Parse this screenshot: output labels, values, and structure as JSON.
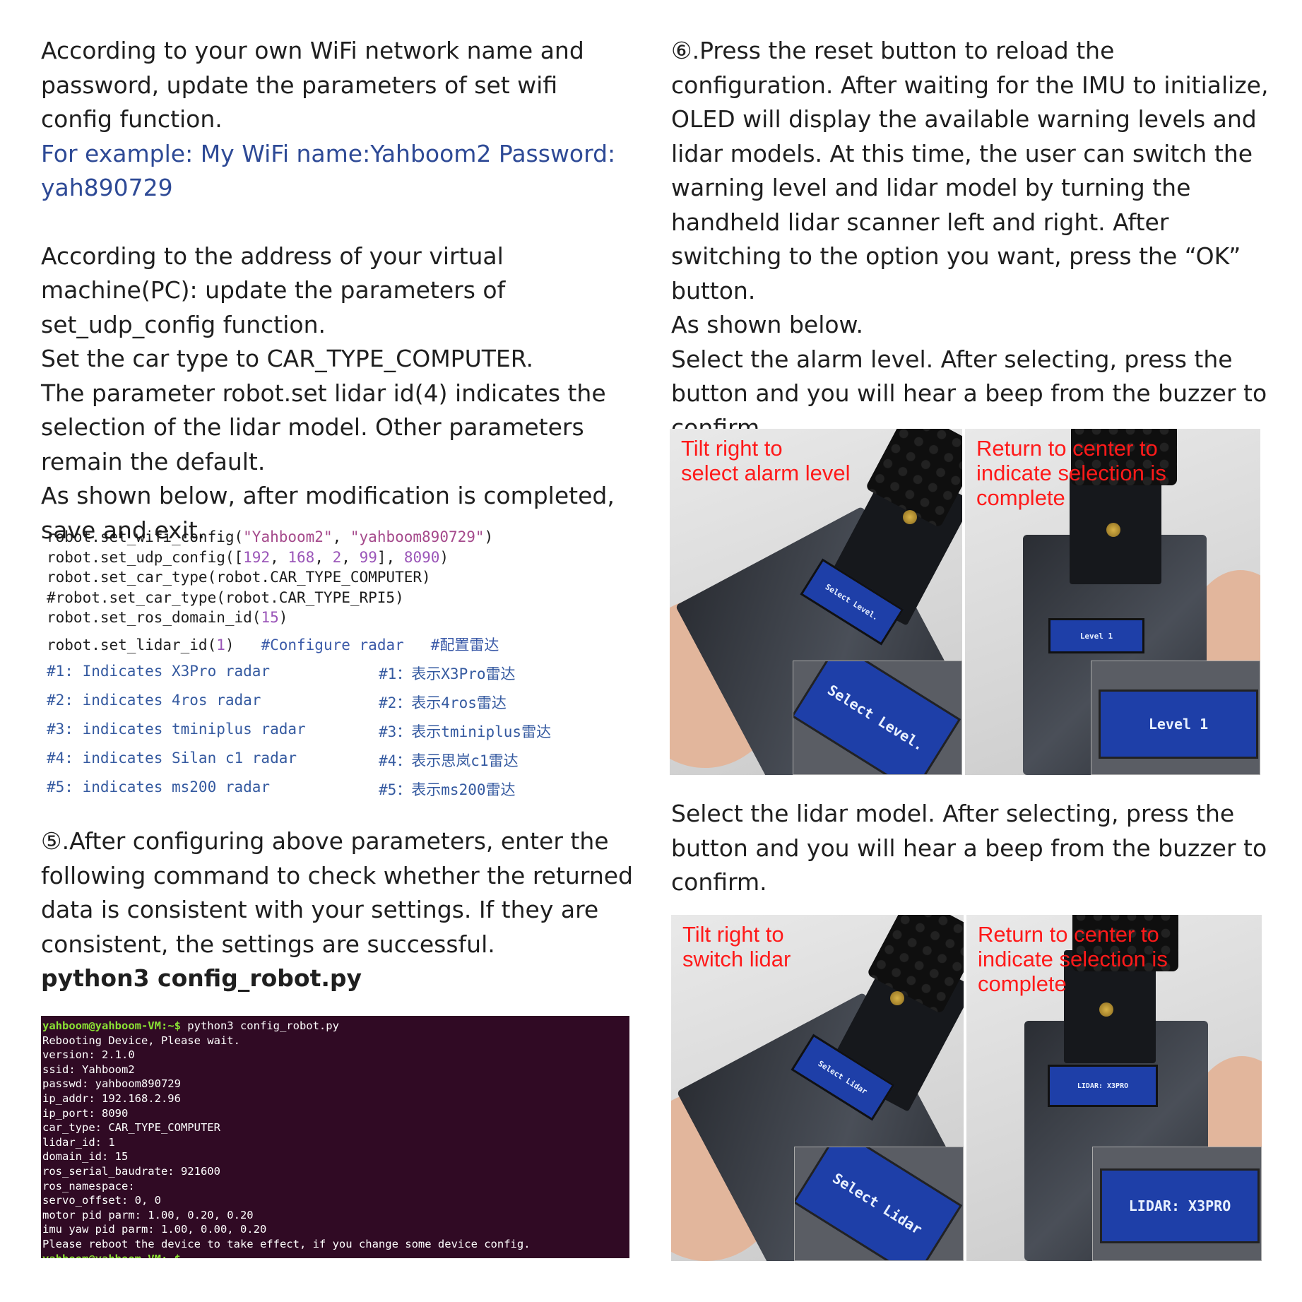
{
  "left": {
    "p1": "According to your own WiFi network name and password, update the parameters of set wifi config function.",
    "p2": "For example: My WiFi name:Yahboom2  Password: yah890729",
    "p3a": "According to the address of your virtual machine(PC): update the parameters of set_udp_config function.",
    "p3b": "Set the car type to CAR_TYPE_COMPUTER.",
    "p3c": "The parameter robot.set lidar id(4) indicates the selection of the lidar model. Other parameters remain the default.",
    "p3d": "As shown below, after modification is completed, save and exit.",
    "p4": "⑤.After configuring above parameters, enter the following command to check whether the returned data is consistent with your settings. If they are consistent, the settings are successful.",
    "command": "python3 config_robot.py"
  },
  "code": {
    "l1a": "robot.set_wifi_config(",
    "l1s1": "\"Yahboom2\"",
    "l1c": ", ",
    "l1s2": "\"yahboom890729\"",
    "l1e": ")",
    "l2a": "robot.set_udp_config([",
    "l2n1": "192",
    "l2c1": ", ",
    "l2n2": "168",
    "l2c2": ", ",
    "l2n3": "2",
    "l2c3": ", ",
    "l2n4": "99",
    "l2c4": "], ",
    "l2n5": "8090",
    "l2e": ")",
    "l3": "robot.set_car_type(robot.CAR_TYPE_COMPUTER)",
    "l4": "#robot.set_car_type(robot.CAR_TYPE_RPI5)",
    "l5a": "robot.set_ros_domain_id(",
    "l5n": "15",
    "l5e": ")",
    "l6a": "robot.set_lidar_id(",
    "l6n": "1",
    "l6e": ")   ",
    "l6c1": "#Configure radar   ",
    "l6c2": "#配置雷达",
    "comments": [
      {
        "en": "#1: Indicates X3Pro radar",
        "zh": "#1：表示X3Pro雷达"
      },
      {
        "en": "#2: indicates 4ros radar",
        "zh": "#2：表示4ros雷达"
      },
      {
        "en": "#3: indicates tminiplus radar",
        "zh": "#3：表示tminiplus雷达"
      },
      {
        "en": "#4: indicates Silan c1 radar",
        "zh": "#4：表示思岚c1雷达"
      },
      {
        "en": "#5: indicates ms200 radar",
        "zh": "#5：表示ms200雷达"
      }
    ]
  },
  "terminal": {
    "prompt": "yahboom@yahboom-VM:~$",
    "cmd": " python3 config_robot.py",
    "lines": [
      "Rebooting Device, Please wait.",
      "version: 2.1.0",
      "ssid: Yahboom2",
      "passwd: yahboom890729",
      "ip_addr: 192.168.2.96",
      "ip_port: 8090",
      "car_type: CAR_TYPE_COMPUTER",
      "lidar_id: 1",
      "domain_id: 15",
      "ros_serial_baudrate: 921600",
      "ros_namespace:",
      "servo_offset: 0, 0",
      "motor pid parm: 1.00, 0.20, 0.20",
      "imu yaw pid parm: 1.00, 0.00, 0.20",
      "Please reboot the device to take effect, if you change some device config."
    ],
    "end_prompt": "yahboom@yahboom-VM:~$"
  },
  "right": {
    "p1": "⑥.Press the reset button to reload the configuration. After waiting for the IMU to initialize, OLED will display the available warning levels and lidar models. At this time, the user can switch the warning level and lidar model by turning the handheld lidar scanner left and right. After switching to the option you want, press the “OK” button.",
    "p2": "As shown below.",
    "p3": "Select the alarm level. After selecting, press the button and you will hear a beep from the buzzer to confirm.",
    "p4": "Select the lidar model. After selecting, press the button and you will hear a beep from the buzzer to confirm."
  },
  "photos1": {
    "cap_left": "Tilt right to\nselect alarm level",
    "cap_right": "Return to center to\nindicate selection is\ncomplete",
    "oled_left": "Select Level.",
    "oled_left_inset": "Select Level.",
    "oled_right": "Level 1",
    "oled_right_inset": "Level 1"
  },
  "photos2": {
    "cap_left": "Tilt right to\nswitch lidar",
    "cap_right": "Return to center to\nindicate selection is\ncomplete",
    "oled_left": "Select Lidar",
    "oled_left_inset": "Select Lidar",
    "oled_right": "LIDAR: X3PRO",
    "oled_right_inset": "LIDAR: X3PRO"
  },
  "colors": {
    "caption_red": "#ff1a1a",
    "link_blue": "#2e4a96",
    "terminal_bg": "#300a24",
    "prompt_green": "#8ae234"
  }
}
